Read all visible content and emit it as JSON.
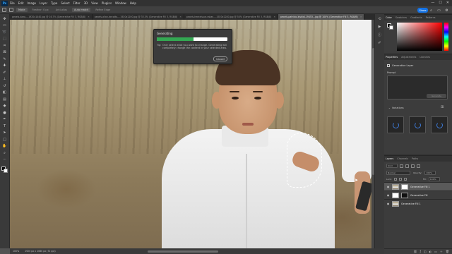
{
  "menu": {
    "app_logo": "Ps",
    "items": [
      "File",
      "Edit",
      "Image",
      "Layer",
      "Type",
      "Select",
      "Filter",
      "3D",
      "View",
      "Plugins",
      "Window",
      "Help"
    ]
  },
  "window_controls": {
    "minimize": "—",
    "maximize": "☐",
    "close": "✕"
  },
  "options_bar": {
    "mode_label": "Mode",
    "feather_label": "Feather: 0 px",
    "anti_alias_label": "Anti-alias",
    "auto_match_label": "Auto match",
    "refine_label": "Refine Edge",
    "share_label": "Share"
  },
  "tabs": [
    {
      "label": "pexels-dazo-...1920x1440.jpg @ 16.7% (Generative Fill 3, RGB/8)",
      "active": false
    },
    {
      "label": "pexels-allan-decotto-...1920x1200.jpg @ 33.3% (Generative Fill 3, RGB/8)",
      "active": false
    },
    {
      "label": "pexels-heeralsuar-rakan-...1920x1280.jpg @ 50% (Generative Fill 3, RGB/8)",
      "active": false
    },
    {
      "label": "pexels-patricio-kiskidi-19453...jpg @ 100% (Generative Fill 3, RGB/8)",
      "active": true
    }
  ],
  "dialog": {
    "title": "Generating",
    "progress": 0.52,
    "tip_label": "Tip:",
    "tip_text": "Only select what you want to change. Generating will completely change the content in your selected area.",
    "cancel_label": "Cancel"
  },
  "status": {
    "zoom": "100%",
    "doc_size": "1920 px x 1080 px (72 ppi)"
  },
  "panels": {
    "color_tabs": [
      "Color",
      "Swatches",
      "Gradients",
      "Patterns"
    ],
    "props_tabs": [
      "Properties",
      "Adjustments",
      "Libraries"
    ],
    "props_item": "Generative Layer",
    "prompt_label": "Prompt",
    "generate_label": "Generate",
    "variations_label": "Variations",
    "layers_tabs": [
      "Layers",
      "Channels",
      "Paths"
    ],
    "layers_kind": "Kind",
    "blend_mode": "Normal",
    "opacity_label": "Opacity:",
    "opacity_value": "100%",
    "lock_label": "Lock:",
    "fill_label": "Fill:",
    "fill_value": "100%",
    "layers": [
      {
        "name": "Generative Fill 1",
        "selected": true
      },
      {
        "name": "Generative Fill",
        "selected": false
      },
      {
        "name": "Generative Fill 1",
        "selected": false
      }
    ]
  },
  "colors": {
    "accent": "#1473e6",
    "progress": "#33a852",
    "ui_dark": "#323232"
  }
}
